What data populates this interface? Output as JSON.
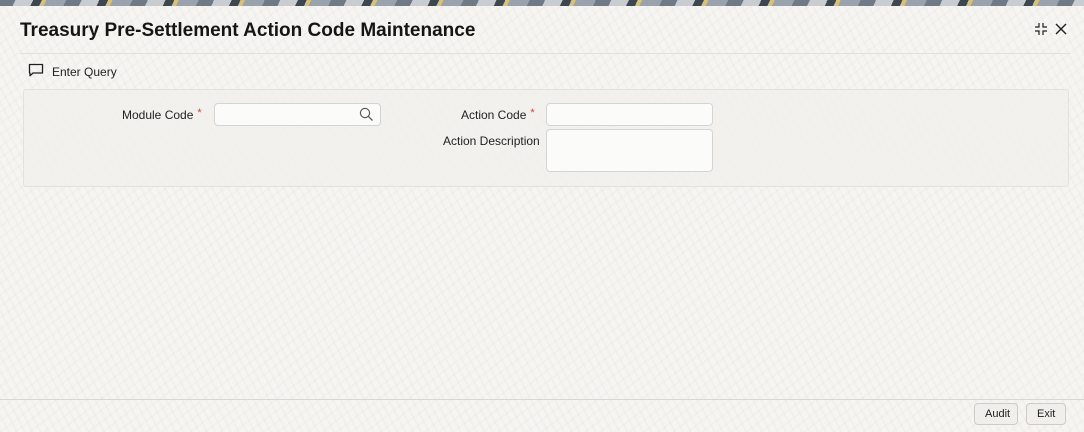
{
  "window": {
    "title": "Treasury Pre-Settlement Action Code Maintenance",
    "controls": [
      "collapse-icon",
      "close-icon"
    ]
  },
  "toolbar": {
    "enter_query_label": "Enter Query",
    "enter_query_icon": "comment-icon"
  },
  "form": {
    "module_code": {
      "label": "Module Code",
      "required_marker": "*",
      "value": "",
      "lookup_icon": "search-icon"
    },
    "action_code": {
      "label": "Action Code",
      "required_marker": "*",
      "value": ""
    },
    "action_description": {
      "label": "Action Description",
      "value": ""
    }
  },
  "footer": {
    "audit_label": "Audit",
    "exit_label": "Exit"
  },
  "colors": {
    "required": "#c74634",
    "title_text": "#161513",
    "background": "#f6f5f2"
  }
}
